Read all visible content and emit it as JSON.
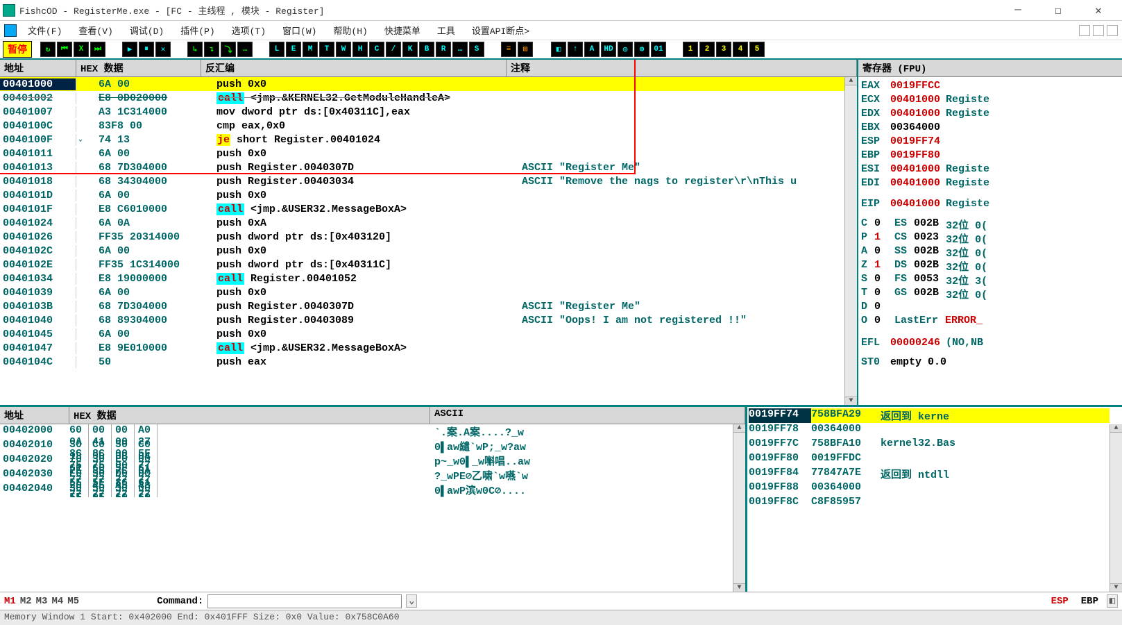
{
  "window": {
    "title": "FishcOD - RegisterMe.exe - [FC - 主线程 , 模块 - Register]"
  },
  "menu": {
    "items": [
      "文件(F)",
      "查看(V)",
      "调试(D)",
      "插件(P)",
      "选项(T)",
      "窗口(W)",
      "帮助(H)",
      "快捷菜单",
      "工具",
      "设置API断点>"
    ]
  },
  "toolbar": {
    "pause_label": "暂停",
    "groups": [
      [
        "↻",
        "⏮",
        "X",
        "⏭"
      ],
      [
        "▶",
        "⏸",
        "✕"
      ],
      [
        "↳",
        "↴",
        "⤵",
        "…"
      ],
      [
        "L",
        "E",
        "M",
        "T",
        "W",
        "H",
        "C",
        "/",
        "K",
        "B",
        "R",
        "…",
        "S"
      ],
      [
        "≡",
        "⊞"
      ],
      [
        "◧",
        "↑",
        "A",
        "HD",
        "◎",
        "⊕",
        "01"
      ],
      [
        "1",
        "2",
        "3",
        "4",
        "5"
      ]
    ]
  },
  "disasm": {
    "headers": {
      "addr": "地址",
      "hex": "HEX 数据",
      "dis": "反汇编",
      "cmt": "注释"
    },
    "rows": [
      {
        "addr": "00401000",
        "hex": "6A 00",
        "dis": "push 0x0",
        "cmt": "",
        "hl": true
      },
      {
        "addr": "00401002",
        "hex": "E8 0D020000",
        "dis_pre": "call",
        "dis_rest": " <jmp.&KERNEL32.GetModuleHandleA>",
        "cmt": "",
        "strike": true,
        "call": true
      },
      {
        "addr": "00401007",
        "hex": "A3 1C314000",
        "dis": "mov dword ptr ds:[0x40311C],eax",
        "cmt": ""
      },
      {
        "addr": "0040100C",
        "hex": "83F8 00",
        "dis": "cmp eax,0x0",
        "cmt": ""
      },
      {
        "addr": "0040100F",
        "hex": "74 13",
        "dis_pre": "je",
        "dis_rest": " short Register.00401024",
        "cmt": "",
        "je": true,
        "chev": true
      },
      {
        "addr": "00401011",
        "hex": "6A 00",
        "dis": "push 0x0",
        "cmt": ""
      },
      {
        "addr": "00401013",
        "hex": "68 7D304000",
        "dis": "push Register.0040307D",
        "cmt": "ASCII \"Register Me\""
      },
      {
        "addr": "00401018",
        "hex": "68 34304000",
        "dis": "push Register.00403034",
        "cmt": "ASCII \"Remove the nags to register\\r\\nThis u"
      },
      {
        "addr": "0040101D",
        "hex": "6A 00",
        "dis": "push 0x0",
        "cmt": ""
      },
      {
        "addr": "0040101F",
        "hex": "E8 C6010000",
        "dis_pre": "call",
        "dis_rest": " <jmp.&USER32.MessageBoxA>",
        "cmt": "",
        "call": true
      },
      {
        "addr": "00401024",
        "hex": "6A 0A",
        "dis": "push 0xA",
        "cmt": ""
      },
      {
        "addr": "00401026",
        "hex": "FF35 20314000",
        "dis": "push dword ptr ds:[0x403120]",
        "cmt": ""
      },
      {
        "addr": "0040102C",
        "hex": "6A 00",
        "dis": "push 0x0",
        "cmt": ""
      },
      {
        "addr": "0040102E",
        "hex": "FF35 1C314000",
        "dis": "push dword ptr ds:[0x40311C]",
        "cmt": ""
      },
      {
        "addr": "00401034",
        "hex": "E8 19000000",
        "dis_pre": "call",
        "dis_rest": " Register.00401052",
        "cmt": "",
        "call": true
      },
      {
        "addr": "00401039",
        "hex": "6A 00",
        "dis": "push 0x0",
        "cmt": ""
      },
      {
        "addr": "0040103B",
        "hex": "68 7D304000",
        "dis": "push Register.0040307D",
        "cmt": "ASCII \"Register Me\""
      },
      {
        "addr": "00401040",
        "hex": "68 89304000",
        "dis": "push Register.00403089",
        "cmt": "ASCII \"Oops! I am not registered !!\""
      },
      {
        "addr": "00401045",
        "hex": "6A 00",
        "dis": "push 0x0",
        "cmt": ""
      },
      {
        "addr": "00401047",
        "hex": "E8 9E010000",
        "dis_pre": "call",
        "dis_rest": " <jmp.&USER32.MessageBoxA>",
        "cmt": "",
        "call": true
      },
      {
        "addr": "0040104C",
        "hex": "50",
        "dis": "push eax",
        "cmt": ""
      }
    ]
  },
  "registers": {
    "title": "寄存器 (FPU)",
    "main": [
      {
        "n": "EAX",
        "v": "0019FFCC",
        "red": true
      },
      {
        "n": "ECX",
        "v": "00401000",
        "t": "Registe",
        "red": true
      },
      {
        "n": "EDX",
        "v": "00401000",
        "t": "Registe",
        "red": true
      },
      {
        "n": "EBX",
        "v": "00364000"
      },
      {
        "n": "ESP",
        "v": "0019FF74",
        "red": true
      },
      {
        "n": "EBP",
        "v": "0019FF80",
        "red": true
      },
      {
        "n": "ESI",
        "v": "00401000",
        "t": "Registe",
        "red": true
      },
      {
        "n": "EDI",
        "v": "00401000",
        "t": "Registe",
        "red": true
      }
    ],
    "eip": {
      "n": "EIP",
      "v": "00401000",
      "t": "Registe",
      "red": true
    },
    "flags": [
      {
        "f": "C",
        "v": "0",
        "seg": "ES",
        "sv": "002B",
        "ex": "32位 0("
      },
      {
        "f": "P",
        "v": "1",
        "vred": true,
        "seg": "CS",
        "sv": "0023",
        "ex": "32位 0("
      },
      {
        "f": "A",
        "v": "0",
        "seg": "SS",
        "sv": "002B",
        "ex": "32位 0("
      },
      {
        "f": "Z",
        "v": "1",
        "vred": true,
        "seg": "DS",
        "sv": "002B",
        "ex": "32位 0("
      },
      {
        "f": "S",
        "v": "0",
        "seg": "FS",
        "sv": "0053",
        "ex": "32位 3("
      },
      {
        "f": "T",
        "v": "0",
        "seg": "GS",
        "sv": "002B",
        "ex": "32位 0("
      },
      {
        "f": "D",
        "v": "0"
      },
      {
        "f": "O",
        "v": "0",
        "seg": "LastErr",
        "sv": "ERROR_",
        "segred": true
      }
    ],
    "efl": {
      "n": "EFL",
      "v": "00000246",
      "t": "(NO,NB",
      "red": true
    },
    "st0": {
      "n": "ST0",
      "v": "empty 0.0"
    }
  },
  "dump": {
    "headers": {
      "addr": "地址",
      "hex": "HEX 数据",
      "asc": "ASCII"
    },
    "rows": [
      {
        "addr": "00402000",
        "b": [
          "60",
          "0A",
          "8C",
          "75",
          "00",
          "41",
          "8C",
          "75",
          "00",
          "00",
          "00",
          "00",
          "A0",
          "27",
          "5F",
          "77"
        ],
        "asc": "`.案.A案....?_w"
      },
      {
        "addr": "00402010",
        "b": [
          "30",
          "18",
          "61",
          "77",
          "C0",
          "50",
          "60",
          "77",
          "50",
          "3B",
          "5F",
          "77",
          "C0",
          "04",
          "61",
          "77"
        ],
        "asc": "0▌aw繾`wP;_w?aw"
      },
      {
        "addr": "00402020",
        "b": [
          "70",
          "7E",
          "5F",
          "77",
          "30",
          "85",
          "5F",
          "77",
          "E0",
          "7C",
          "86",
          "77",
          "00",
          "0A",
          "61",
          "77"
        ],
        "asc": "p~_w0▌_w嘝唱..aw"
      },
      {
        "addr": "00402030",
        "b": [
          "E0",
          "20",
          "5F",
          "77",
          "50",
          "45",
          "05",
          "5A",
          "D0",
          "A5",
          "60",
          "77",
          "D0",
          "48",
          "60",
          "77"
        ],
        "asc": "?_wPE⊘乙啸`w嚥`w"
      },
      {
        "addr": "00402040",
        "b": [
          "30",
          "14",
          "61",
          "77",
          "50",
          "9C",
          "5F",
          "77",
          "30",
          "43",
          "05",
          "5A",
          "00",
          "00",
          "00",
          "00"
        ],
        "asc": "0▌awP滨w0C⊘...."
      }
    ]
  },
  "stack": {
    "rows": [
      {
        "a": "0019FF74",
        "v": "758BFA29",
        "c": "返回到 kerne",
        "hl": true
      },
      {
        "a": "0019FF78",
        "v": "00364000",
        "c": ""
      },
      {
        "a": "0019FF7C",
        "v": "758BFA10",
        "c": "kernel32.Bas"
      },
      {
        "a": "0019FF80",
        "v": "0019FFDC",
        "c": ""
      },
      {
        "a": "0019FF84",
        "v": "77847A7E",
        "c": "返回到 ntdll"
      },
      {
        "a": "0019FF88",
        "v": "00364000",
        "c": ""
      },
      {
        "a": "0019FF8C",
        "v": "C8F85957",
        "c": ""
      }
    ]
  },
  "cmdbar": {
    "tabs": [
      "M1",
      "M2",
      "M3",
      "M4",
      "M5"
    ],
    "cmd_label": "Command:",
    "esp": "ESP",
    "ebp": "EBP"
  },
  "status": "Memory Window 1  Start: 0x402000  End: 0x401FFF  Size: 0x0 Value: 0x758C0A60"
}
